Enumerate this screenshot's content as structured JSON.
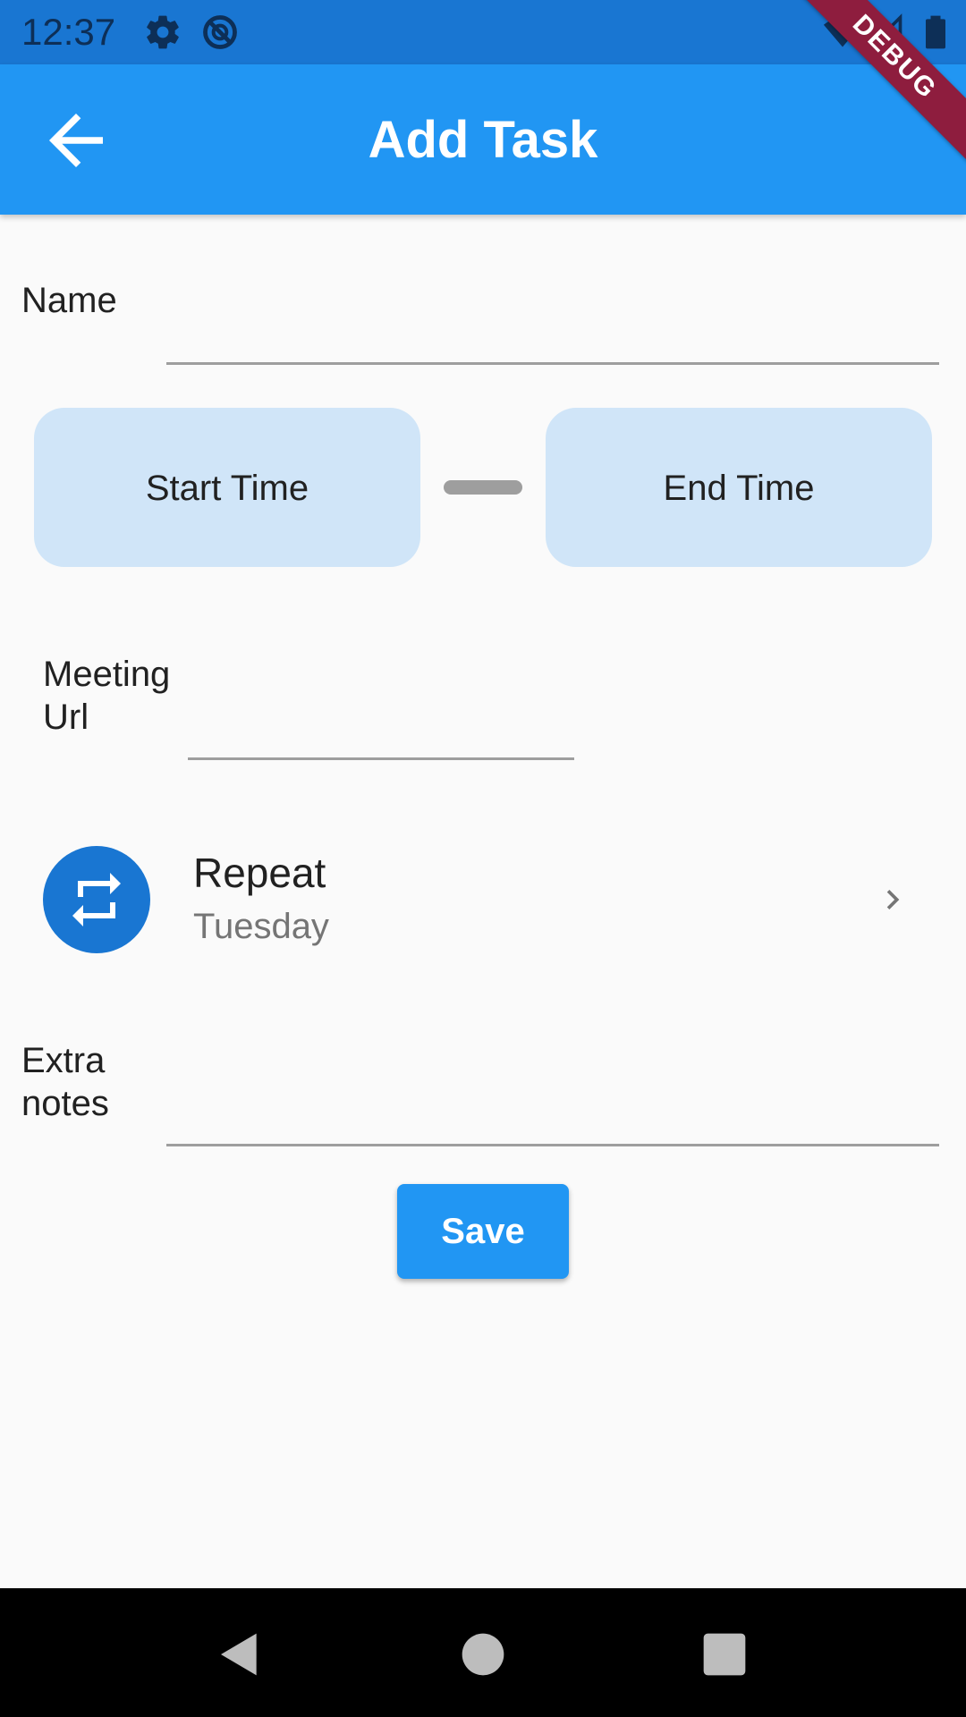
{
  "status_bar": {
    "time": "12:37",
    "icons": [
      "gear-icon",
      "do-not-disturb-icon",
      "wifi-icon",
      "cell-signal-icon",
      "battery-icon"
    ]
  },
  "app_bar": {
    "title": "Add Task",
    "back_icon": "arrow-back-icon",
    "color": "#2196f3"
  },
  "debug_banner": "DEBUG",
  "form": {
    "name_label": "Name",
    "name_value": "",
    "start_time_label": "Start Time",
    "end_time_label": "End Time",
    "meeting_url_label_line1": "Meeting",
    "meeting_url_label_line2": "Url",
    "meeting_url_value": "",
    "repeat": {
      "title": "Repeat",
      "value": "Tuesday",
      "icon": "repeat-icon",
      "chevron": "chevron-right-icon"
    },
    "extra_notes_label_line1": "Extra",
    "extra_notes_label_line2": "notes",
    "extra_notes_value": "",
    "save_label": "Save"
  },
  "nav_bar": {
    "icons": [
      "nav-back-icon",
      "nav-home-icon",
      "nav-recents-icon"
    ]
  },
  "colors": {
    "primary": "#2196f3",
    "primary_dark": "#1976d2",
    "time_button_bg": "#d0e5f8",
    "debug_ribbon": "#8e1d3e"
  }
}
